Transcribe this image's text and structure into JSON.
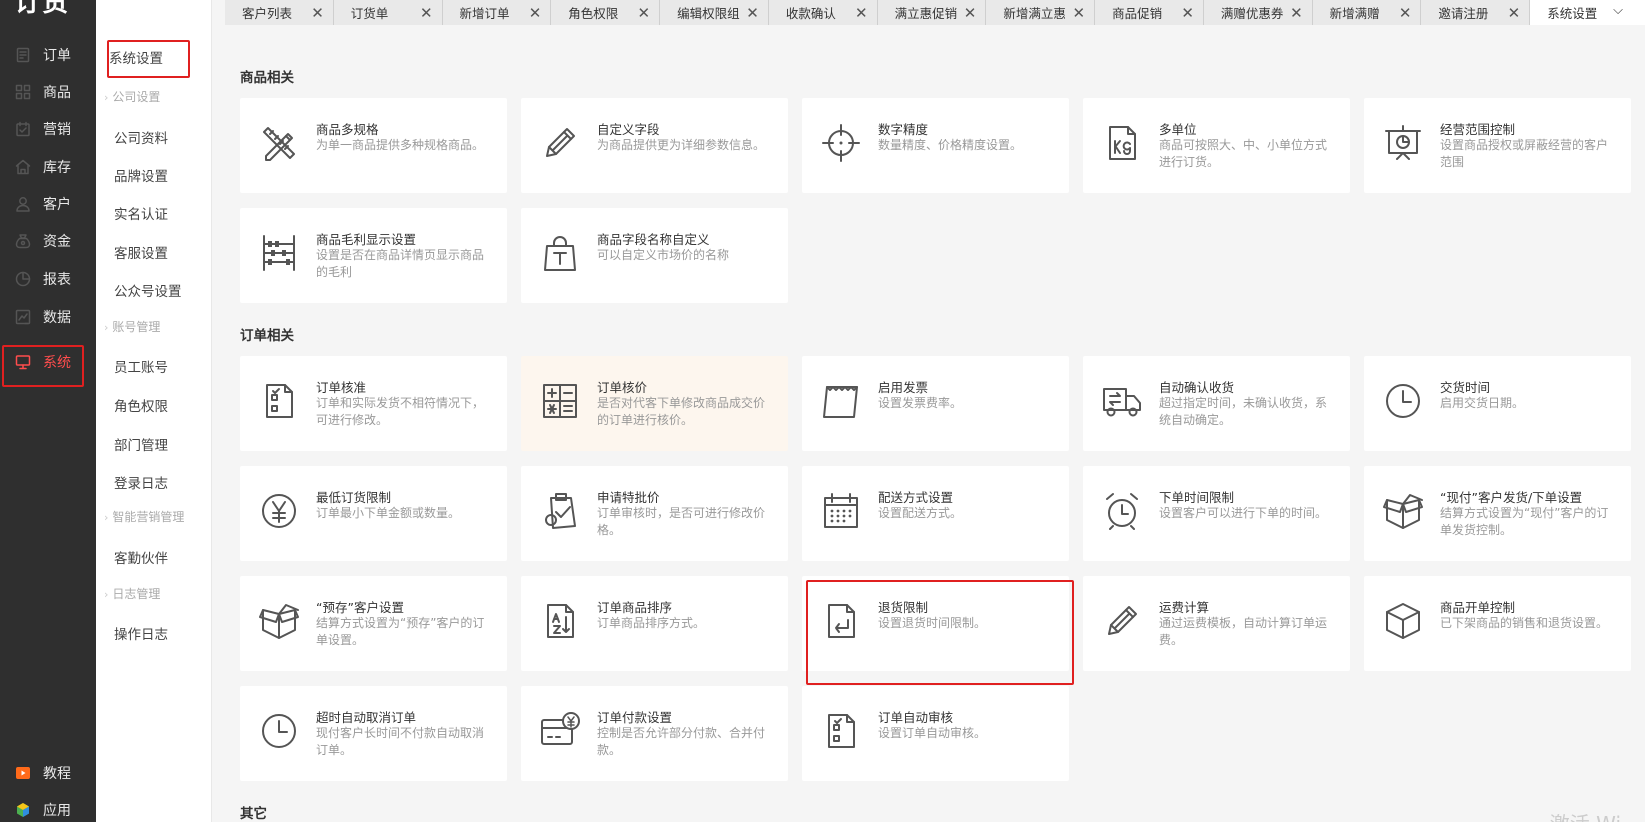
{
  "app": {
    "logo": "订货宝"
  },
  "nav": {
    "items": [
      {
        "label": "订单",
        "icon": "order-icon"
      },
      {
        "label": "商品",
        "icon": "goods-icon"
      },
      {
        "label": "营销",
        "icon": "marketing-icon"
      },
      {
        "label": "库存",
        "icon": "inventory-icon"
      },
      {
        "label": "客户",
        "icon": "customer-icon"
      },
      {
        "label": "资金",
        "icon": "funds-icon"
      },
      {
        "label": "报表",
        "icon": "report-icon"
      },
      {
        "label": "数据",
        "icon": "data-icon"
      },
      {
        "label": "系统",
        "icon": "system-icon",
        "active": true
      },
      {
        "label": "教程",
        "icon": "tutorial-icon"
      },
      {
        "label": "应用",
        "icon": "apps-icon"
      }
    ]
  },
  "subnav": {
    "top": "系统设置",
    "groups": [
      {
        "title": "公司设置",
        "items": [
          "公司资料",
          "品牌设置",
          "实名认证",
          "客服设置",
          "公众号设置"
        ]
      },
      {
        "title": "账号管理",
        "items": [
          "员工账号",
          "角色权限",
          "部门管理",
          "登录日志"
        ]
      },
      {
        "title": "智能营销管理",
        "items": [
          "客勤伙伴"
        ]
      },
      {
        "title": "日志管理",
        "items": [
          "操作日志"
        ]
      }
    ]
  },
  "tabs": [
    {
      "label": "客户列表"
    },
    {
      "label": "订货单"
    },
    {
      "label": "新增订单"
    },
    {
      "label": "角色权限"
    },
    {
      "label": "编辑权限组"
    },
    {
      "label": "收款确认"
    },
    {
      "label": "满立惠促销"
    },
    {
      "label": "新增满立惠"
    },
    {
      "label": "商品促销"
    },
    {
      "label": "满赠优惠券"
    },
    {
      "label": "新增满赠"
    },
    {
      "label": "邀请注册"
    },
    {
      "label": "系统设置",
      "active": true
    }
  ],
  "tab_close": "✕",
  "tab_more": "⌵",
  "sections": [
    {
      "title": "商品相关",
      "cards": [
        {
          "title": "商品多规格",
          "desc": "为单一商品提供多种规格商品。",
          "icon": "ruler-pencil-icon"
        },
        {
          "title": "自定义字段",
          "desc": "为商品提供更为详细参数信息。",
          "icon": "pencil-icon"
        },
        {
          "title": "数字精度",
          "desc": "数量精度、价格精度设置。",
          "icon": "crosshair-icon"
        },
        {
          "title": "多单位",
          "desc": "商品可按照大、中、小单位方式进行订货。",
          "icon": "kg-weight-icon"
        },
        {
          "title": "经营范围控制",
          "desc": "设置商品授权或屏蔽经营的客户范围",
          "icon": "presentation-chart-icon"
        },
        {
          "title": "商品毛利显示设置",
          "desc": "设置是否在商品详情页显示商品的毛利",
          "icon": "abacus-icon"
        },
        {
          "title": "商品字段名称自定义",
          "desc": "可以自定义市场价的名称",
          "icon": "shopping-bag-text-icon"
        }
      ]
    },
    {
      "title": "订单相关",
      "cards": [
        {
          "title": "订单核准",
          "desc": "订单和实际发货不相符情况下，可进行修改。",
          "icon": "checklist-icon"
        },
        {
          "title": "订单核价",
          "desc": "是否对代客下单修改商品成交价的订单进行核价。",
          "icon": "calculator-icon",
          "highlight": true
        },
        {
          "title": "启用发票",
          "desc": "设置发票费率。",
          "icon": "invoice-icon"
        },
        {
          "title": "自动确认收货",
          "desc": "超过指定时间，未确认收货，系统自动确定。",
          "icon": "truck-icon"
        },
        {
          "title": "交货时间",
          "desc": "启用交货日期。",
          "icon": "clock-icon"
        },
        {
          "title": "最低订货限制",
          "desc": "订单最小下单金额或数量。",
          "icon": "yen-coin-icon"
        },
        {
          "title": "申请特批价",
          "desc": "订单审核时，是否可进行修改价格。",
          "icon": "approval-clipboard-icon"
        },
        {
          "title": "配送方式设置",
          "desc": "设置配送方式。",
          "icon": "calendar-icon"
        },
        {
          "title": "下单时间限制",
          "desc": "设置客户可以进行下单的时间。",
          "icon": "alarm-clock-icon"
        },
        {
          "title": "“现付”客户发货/下单设置",
          "desc": "结算方式设置为“现付”客户的订单发货控制。",
          "icon": "open-box-icon"
        },
        {
          "title": "“预存”客户设置",
          "desc": "结算方式设置为“预存”客户的订单设置。",
          "icon": "open-box-icon"
        },
        {
          "title": "订单商品排序",
          "desc": "订单商品排序方式。",
          "icon": "sort-az-icon"
        },
        {
          "title": "退货限制",
          "desc": "设置退货时间限制。",
          "icon": "return-doc-icon"
        },
        {
          "title": "运费计算",
          "desc": "通过运费模板，自动计算订单运费。",
          "icon": "pencil-icon"
        },
        {
          "title": "商品开单控制",
          "desc": "已下架商品的销售和退货设置。",
          "icon": "cube-icon"
        },
        {
          "title": "超时自动取消订单",
          "desc": "现付客户长时间不付款自动取消订单。",
          "icon": "clock-icon"
        },
        {
          "title": "订单付款设置",
          "desc": "控制是否允许部分付款、合并付款。",
          "icon": "payment-card-icon"
        },
        {
          "title": "订单自动审核",
          "desc": "设置订单自动审核。",
          "icon": "checklist-icon"
        }
      ]
    },
    {
      "title": "其它",
      "cards": []
    }
  ],
  "watermark": "激活 Wi"
}
